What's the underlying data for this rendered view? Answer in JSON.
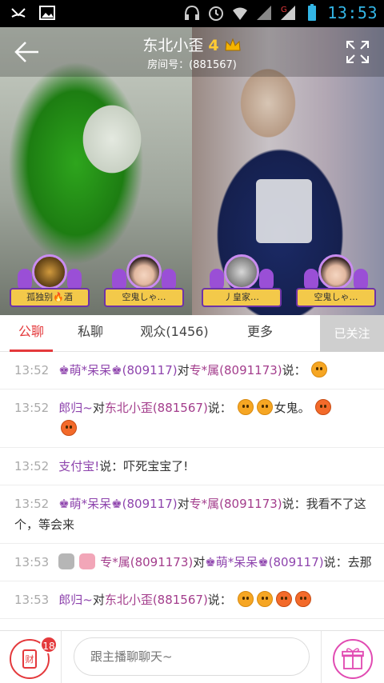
{
  "status_bar": {
    "time": "13:53",
    "icons": [
      "missed-call-icon",
      "image-icon",
      "headset-icon",
      "alarm-icon",
      "wifi-icon",
      "signal-icon",
      "signal-g-icon",
      "battery-icon"
    ],
    "clock_color": "#33b5e5"
  },
  "room": {
    "title": "东北小歪",
    "level": "4",
    "room_id": "房间号：(881567)"
  },
  "seats": [
    {
      "name": "孤独别🔥酒"
    },
    {
      "name": "空鬼しゃ…"
    },
    {
      "name": "丿皇家…"
    },
    {
      "name": "空鬼しゃ…"
    }
  ],
  "tabs": {
    "public": "公聊",
    "private": "私聊",
    "audience": "观众(1456)",
    "more": "更多",
    "follow": "已关注"
  },
  "messages": [
    {
      "time": "13:52",
      "parts": [
        "♚萌*呆呆♚(809117)",
        "对",
        "专*属(8091173)",
        "说："
      ],
      "emoji": 1
    },
    {
      "time": "13:52",
      "parts": [
        "郎归~",
        "对",
        "东北小歪(881567)",
        "说："
      ],
      "tail": "女鬼。",
      "emoji": 4
    },
    {
      "time": "13:52",
      "parts": [
        "支付宝!",
        "说：吓死宝宝了!"
      ]
    },
    {
      "time": "13:52",
      "parts": [
        "♚萌*呆呆♚(809117)",
        "对",
        "专*属(8091173)",
        "说：我看不了这个，等会来"
      ]
    },
    {
      "time": "13:53",
      "parts": [
        "专*属(8091173)",
        "对",
        "♚萌*呆呆♚(809117)",
        "说：去那"
      ]
    },
    {
      "time": "13:53",
      "parts": [
        "郎归~",
        "对",
        "东北小歪(881567)",
        "说："
      ],
      "emoji": 4
    }
  ],
  "bottom": {
    "wallet_label": "财",
    "wallet_badge": "18",
    "input_placeholder": "跟主播聊聊天~"
  },
  "colors": {
    "accent": "#e4393c",
    "username": "#8e44ad",
    "gift": "#e14bb2"
  }
}
